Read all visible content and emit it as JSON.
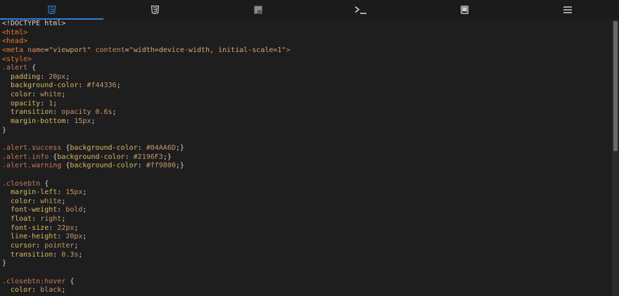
{
  "tabs": [
    {
      "id": "html",
      "icon": "html5-icon",
      "active": true
    },
    {
      "id": "css",
      "icon": "css3-icon",
      "active": false
    },
    {
      "id": "js",
      "icon": "javascript-icon",
      "active": false,
      "text": "JS"
    },
    {
      "id": "console",
      "icon": "terminal-icon",
      "active": false
    },
    {
      "id": "preview",
      "icon": "tablet-icon",
      "active": false
    },
    {
      "id": "menu",
      "icon": "hamburger-menu-icon",
      "active": false
    }
  ],
  "colors": {
    "accent": "#2f7fd6",
    "background": "#1e1e1e",
    "default": "#d4d4d4",
    "tag": "#e2762d",
    "attr": "#cf8d53",
    "string": "#d6a96e",
    "selector": "#c77a5a",
    "property": "#d9bb57",
    "value": "#c4996a",
    "icon": "#cfcfcf"
  },
  "code_lines": [
    [
      [
        "<!DOCTYPE html>",
        "default"
      ]
    ],
    [
      [
        "<html>",
        "tag"
      ]
    ],
    [
      [
        "<head>",
        "tag"
      ]
    ],
    [
      [
        "<meta ",
        "tag"
      ],
      [
        "name",
        "attr"
      ],
      [
        "=",
        "default"
      ],
      [
        "\"viewport\"",
        "string"
      ],
      [
        " ",
        "default"
      ],
      [
        "content",
        "attr"
      ],
      [
        "=",
        "default"
      ],
      [
        "\"width=device-width, initial-scale=1\"",
        "string"
      ],
      [
        ">",
        "tag"
      ]
    ],
    [
      [
        "<style>",
        "tag"
      ]
    ],
    [
      [
        ".alert",
        "selector"
      ],
      [
        " {",
        "default"
      ]
    ],
    [
      [
        "  padding",
        "property"
      ],
      [
        ": ",
        "default"
      ],
      [
        "20px",
        "value"
      ],
      [
        ";",
        "default"
      ]
    ],
    [
      [
        "  background-color",
        "property"
      ],
      [
        ": ",
        "default"
      ],
      [
        "#f44336",
        "value"
      ],
      [
        ";",
        "default"
      ]
    ],
    [
      [
        "  color",
        "property"
      ],
      [
        ": ",
        "default"
      ],
      [
        "white",
        "value"
      ],
      [
        ";",
        "default"
      ]
    ],
    [
      [
        "  opacity",
        "property"
      ],
      [
        ": ",
        "default"
      ],
      [
        "1",
        "value"
      ],
      [
        ";",
        "default"
      ]
    ],
    [
      [
        "  transition",
        "property"
      ],
      [
        ": ",
        "default"
      ],
      [
        "opacity 0.6s",
        "value"
      ],
      [
        ";",
        "default"
      ]
    ],
    [
      [
        "  margin-bottom",
        "property"
      ],
      [
        ": ",
        "default"
      ],
      [
        "15px",
        "value"
      ],
      [
        ";",
        "default"
      ]
    ],
    [
      [
        "}",
        "default"
      ]
    ],
    [],
    [
      [
        ".alert.success",
        "selector"
      ],
      [
        " {",
        "default"
      ],
      [
        "background-color",
        "property"
      ],
      [
        ": ",
        "default"
      ],
      [
        "#04AA6D",
        "value"
      ],
      [
        ";}",
        "default"
      ]
    ],
    [
      [
        ".alert.info",
        "selector"
      ],
      [
        " {",
        "default"
      ],
      [
        "background-color",
        "property"
      ],
      [
        ": ",
        "default"
      ],
      [
        "#2196F3",
        "value"
      ],
      [
        ";}",
        "default"
      ]
    ],
    [
      [
        ".alert.warning",
        "selector"
      ],
      [
        " {",
        "default"
      ],
      [
        "background-color",
        "property"
      ],
      [
        ": ",
        "default"
      ],
      [
        "#ff9800",
        "value"
      ],
      [
        ";}",
        "default"
      ]
    ],
    [],
    [
      [
        ".closebtn",
        "selector"
      ],
      [
        " {",
        "default"
      ]
    ],
    [
      [
        "  margin-left",
        "property"
      ],
      [
        ": ",
        "default"
      ],
      [
        "15px",
        "value"
      ],
      [
        ";",
        "default"
      ]
    ],
    [
      [
        "  color",
        "property"
      ],
      [
        ": ",
        "default"
      ],
      [
        "white",
        "value"
      ],
      [
        ";",
        "default"
      ]
    ],
    [
      [
        "  font-weight",
        "property"
      ],
      [
        ": ",
        "default"
      ],
      [
        "bold",
        "value"
      ],
      [
        ";",
        "default"
      ]
    ],
    [
      [
        "  float",
        "property"
      ],
      [
        ": ",
        "default"
      ],
      [
        "right",
        "value"
      ],
      [
        ";",
        "default"
      ]
    ],
    [
      [
        "  font-size",
        "property"
      ],
      [
        ": ",
        "default"
      ],
      [
        "22px",
        "value"
      ],
      [
        ";",
        "default"
      ]
    ],
    [
      [
        "  line-height",
        "property"
      ],
      [
        ": ",
        "default"
      ],
      [
        "20px",
        "value"
      ],
      [
        ";",
        "default"
      ]
    ],
    [
      [
        "  cursor",
        "property"
      ],
      [
        ": ",
        "default"
      ],
      [
        "pointer",
        "value"
      ],
      [
        ";",
        "default"
      ]
    ],
    [
      [
        "  transition",
        "property"
      ],
      [
        ": ",
        "default"
      ],
      [
        "0.3s",
        "value"
      ],
      [
        ";",
        "default"
      ]
    ],
    [
      [
        "}",
        "default"
      ]
    ],
    [],
    [
      [
        ".closebtn:hover",
        "selector"
      ],
      [
        " {",
        "default"
      ]
    ],
    [
      [
        "  color",
        "property"
      ],
      [
        ": ",
        "default"
      ],
      [
        "black",
        "value"
      ],
      [
        ";",
        "default"
      ]
    ]
  ]
}
